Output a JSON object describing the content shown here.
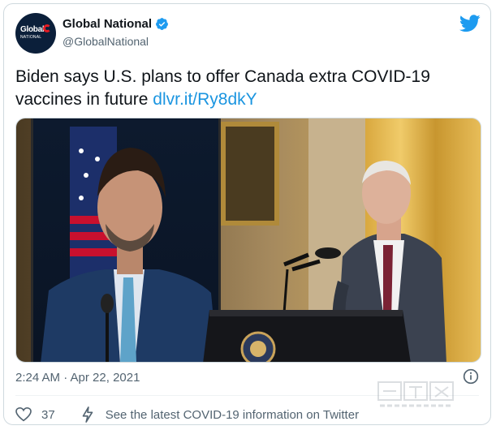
{
  "account": {
    "name": "Global National",
    "handle": "@GlobalNational",
    "avatar_text": "Global",
    "avatar_subtext": "NATIONAL"
  },
  "tweet": {
    "text": "Biden says U.S. plans to offer Canada extra COVID-19 vaccines in future ",
    "link": "dlvr.it/Ry8dkY"
  },
  "meta": {
    "timestamp": "2:24 AM · Apr 22, 2021"
  },
  "actions": {
    "like_count": "37",
    "covid_info": "See the latest COVID-19 information on Twitter"
  },
  "watermark": {
    "line1": "加西网",
    "line2": "westca.com"
  },
  "colors": {
    "link": "#1b95e0",
    "twitter_blue": "#1d9bf0",
    "muted": "#536471"
  },
  "icons": [
    "verified-badge-icon",
    "twitter-bird-icon",
    "info-icon",
    "heart-icon",
    "bolt-icon"
  ]
}
